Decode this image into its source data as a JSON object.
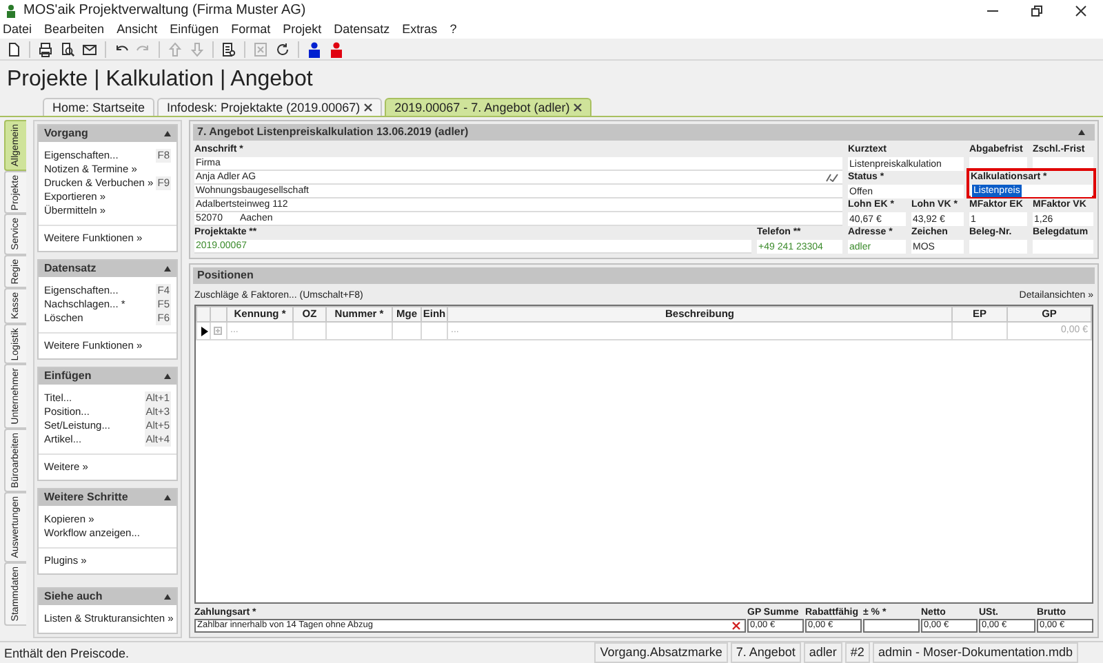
{
  "window": {
    "title": "MOS'aik Projektverwaltung (Firma Muster AG)"
  },
  "menu": [
    "Datei",
    "Bearbeiten",
    "Ansicht",
    "Einfügen",
    "Format",
    "Projekt",
    "Datensatz",
    "Extras",
    "?"
  ],
  "toolbar": [
    [
      {
        "kind": "new",
        "disabled": false
      }
    ],
    [
      {
        "kind": "print",
        "disabled": false
      },
      {
        "kind": "preview",
        "disabled": false
      },
      {
        "kind": "mail",
        "disabled": false
      }
    ],
    [
      {
        "kind": "undo",
        "disabled": false
      },
      {
        "kind": "redo",
        "disabled": true
      }
    ],
    [
      {
        "kind": "up",
        "disabled": true
      },
      {
        "kind": "down",
        "disabled": true
      }
    ],
    [
      {
        "kind": "document",
        "disabled": false
      }
    ],
    [
      {
        "kind": "cancel",
        "disabled": true
      },
      {
        "kind": "refresh",
        "disabled": false
      }
    ],
    [
      {
        "kind": "figure",
        "color": "#0020d0",
        "disabled": false
      },
      {
        "kind": "figure",
        "color": "#e00010",
        "disabled": false
      }
    ]
  ],
  "breadcrumb": "Projekte | Kalkulation | Angebot",
  "doc_tabs": [
    {
      "label": "Home: Startseite",
      "closable": false,
      "selected": false
    },
    {
      "label": "Infodesk: Projektakte (2019.00067)",
      "closable": true,
      "selected": false
    },
    {
      "label": "2019.00067 - 7. Angebot (adler)",
      "closable": true,
      "selected": true
    }
  ],
  "side_tabs": [
    {
      "label": "Allgemein",
      "selected": true
    },
    {
      "label": "Projekte",
      "selected": false
    },
    {
      "label": "Service",
      "selected": false
    },
    {
      "label": "Regie",
      "selected": false
    },
    {
      "label": "Kasse",
      "selected": false
    },
    {
      "label": "Logistik",
      "selected": false
    },
    {
      "label": "Unternehmer",
      "selected": false
    },
    {
      "label": "Büroarbeiten",
      "selected": false
    },
    {
      "label": "Auswertungen",
      "selected": false
    },
    {
      "label": "Stammdaten",
      "selected": false
    }
  ],
  "panels": [
    {
      "title": "Vorgang",
      "expanded": true,
      "groups": [
        [
          {
            "label": "Eigenschaften...",
            "shortcut": "F8"
          },
          {
            "label": "Notizen & Termine »"
          },
          {
            "label": "Drucken & Verbuchen »",
            "shortcut": "F9"
          },
          {
            "label": "Exportieren »"
          },
          {
            "label": "Übermitteln »"
          }
        ],
        [
          {
            "label": "Weitere Funktionen »"
          }
        ]
      ]
    },
    {
      "title": "Datensatz",
      "expanded": true,
      "groups": [
        [
          {
            "label": "Eigenschaften...",
            "shortcut": "F4"
          },
          {
            "label": "Nachschlagen... *",
            "shortcut": "F5"
          },
          {
            "label": "Löschen",
            "shortcut": "F6"
          }
        ],
        [
          {
            "label": "Weitere Funktionen »"
          }
        ]
      ]
    },
    {
      "title": "Einfügen",
      "expanded": true,
      "groups": [
        [
          {
            "label": "Titel...",
            "shortcut": "Alt+1"
          },
          {
            "label": "Position...",
            "shortcut": "Alt+3"
          },
          {
            "label": "Set/Leistung...",
            "shortcut": "Alt+5"
          },
          {
            "label": "Artikel...",
            "shortcut": "Alt+4"
          }
        ],
        [
          {
            "label": "Weitere »"
          }
        ]
      ]
    },
    {
      "title": "Weitere Schritte",
      "expanded": true,
      "groups": [
        [
          {
            "label": "Kopieren »"
          },
          {
            "label": "Workflow anzeigen..."
          }
        ],
        [
          {
            "label": "Plugins »"
          }
        ]
      ]
    },
    {
      "title": "Siehe auch",
      "expanded": true,
      "groups": [
        [
          {
            "label": "Listen & Strukturansichten »"
          }
        ]
      ]
    }
  ],
  "form": {
    "title": "7. Angebot Listenpreiskalkulation 13.06.2019 (adler)",
    "expanded": true,
    "address": {
      "label": "Anschrift *",
      "lines": [
        {
          "text": "Firma",
          "lookup": false
        },
        {
          "text": "Anja Adler AG",
          "lookup": true
        },
        {
          "text": "Wohnungsbaugesellschaft",
          "lookup": false
        },
        {
          "text": "Adalbertsteinweg 112",
          "lookup": false
        }
      ],
      "zip": "52070",
      "city": "Aachen"
    },
    "fields": [
      {
        "label": "Kurztext",
        "value": "Listenpreiskalkulation",
        "linked": false,
        "focused": false
      },
      {
        "label": "Abgabefrist",
        "focused": false
      },
      {
        "label": "Zschl.-Frist",
        "focused": false
      },
      {
        "label": "Status *",
        "value": "Offen",
        "linked": false,
        "focused": false
      },
      {
        "label": "Kalkulationsart *",
        "value": "Listenpreis",
        "linked": false,
        "focused": true
      },
      {
        "label": "Lohn EK *",
        "value": "40,67 €",
        "linked": false,
        "focused": false
      },
      {
        "label": "Lohn VK *",
        "value": "43,92 €",
        "linked": false,
        "focused": false
      },
      {
        "label": "MFaktor EK",
        "value": "1",
        "linked": false,
        "focused": false
      },
      {
        "label": "MFaktor VK",
        "value": "1,26",
        "linked": false,
        "focused": false
      },
      {
        "label": "Projektakte **",
        "value": "2019.00067",
        "linked": true,
        "focused": false
      },
      {
        "label": "Telefon **",
        "value": "+49 241 23304",
        "linked": true,
        "focused": false
      },
      {
        "label": "Adresse *",
        "value": "adler",
        "linked": true,
        "focused": false
      },
      {
        "label": "Zeichen",
        "value": "MOS",
        "linked": false,
        "focused": false
      },
      {
        "label": "Beleg-Nr.",
        "focused": false
      },
      {
        "label": "Belegdatum",
        "focused": false
      }
    ]
  },
  "positions": {
    "title": "Positionen",
    "action": "Zuschläge & Faktoren... (Umschalt+F8)",
    "detail_link": "Detailansichten »",
    "columns": [
      "Kennung *",
      "OZ",
      "Nummer *",
      "Mge",
      "Einh",
      "Beschreibung",
      "EP",
      "GP"
    ],
    "rows": [
      {
        "selected": true,
        "cells": [
          {
            "text": "...",
            "muted": true
          },
          null,
          null,
          null,
          null,
          {
            "text": "...",
            "muted": true
          },
          null,
          {
            "text": "0,00 €",
            "muted": true
          }
        ]
      }
    ],
    "payment": {
      "label": "Zahlungsart *",
      "value": "Zahlbar innerhalb von 14 Tagen ohne Abzug"
    },
    "totals": [
      {
        "label": "GP Summe",
        "value": "0,00 €"
      },
      {
        "label": "Rabattfähig",
        "value": "0,00 €"
      },
      {
        "label": "± % *"
      },
      {
        "label": "Netto",
        "value": "0,00 €"
      },
      {
        "label": "USt.",
        "value": "0,00 €"
      },
      {
        "label": "Brutto",
        "value": "0,00 €"
      }
    ]
  },
  "status_bar": {
    "message": "Enthält den Preiscode.",
    "panes": [
      "Vorgang.Absatzmarke",
      "7. Angebot",
      "adler",
      "#2",
      "admin - Moser-Dokumentation.mdb"
    ]
  }
}
